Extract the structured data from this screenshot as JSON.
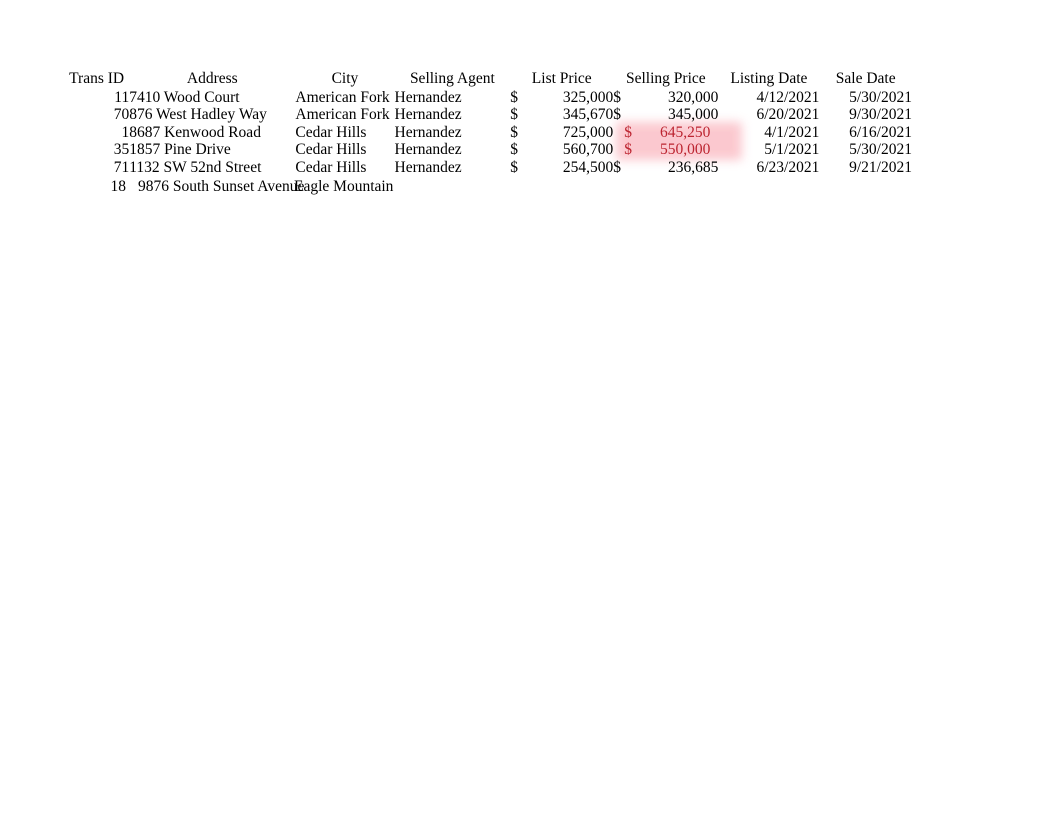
{
  "sheet": {
    "columns": [
      {
        "key": "trans_id",
        "label": "Trans ID",
        "align": "right"
      },
      {
        "key": "address",
        "label": "Address",
        "align": "left"
      },
      {
        "key": "city",
        "label": "City",
        "align": "left"
      },
      {
        "key": "selling_agent",
        "label": "Selling Agent",
        "align": "left"
      },
      {
        "key": "list_price",
        "label": "List Price",
        "align": "right"
      },
      {
        "key": "selling_price",
        "label": "Selling Price",
        "align": "right"
      },
      {
        "key": "listing_date",
        "label": "Listing Date",
        "align": "right"
      },
      {
        "key": "sale_date",
        "label": "Sale Date",
        "align": "right"
      }
    ],
    "currency_symbol": "$",
    "highlight": {
      "background": "#fbc6cd",
      "text_color": "#bc2430",
      "applies_to_column": "selling_price"
    },
    "rows": [
      {
        "trans_id": "11",
        "address": "7410 Wood Court",
        "city": "American Fork",
        "selling_agent": "Hernandez",
        "list_price": "325,000",
        "selling_price": "320,000",
        "selling_price_highlighted": false,
        "listing_date": "4/12/2021",
        "sale_date": "5/30/2021"
      },
      {
        "trans_id": "70",
        "address": "876 West Hadley Way",
        "city": "American Fork",
        "selling_agent": "Hernandez",
        "list_price": "345,670",
        "selling_price": "345,000",
        "selling_price_highlighted": false,
        "listing_date": "6/20/2021",
        "sale_date": "9/30/2021"
      },
      {
        "trans_id": "1",
        "address": "8687 Kenwood Road",
        "city": "Cedar Hills",
        "selling_agent": "Hernandez",
        "list_price": "725,000",
        "selling_price": "645,250",
        "selling_price_highlighted": true,
        "listing_date": "4/1/2021",
        "sale_date": "6/16/2021"
      },
      {
        "trans_id": "35",
        "address": "1857 Pine Drive",
        "city": "Cedar Hills",
        "selling_agent": "Hernandez",
        "list_price": "560,700",
        "selling_price": "550,000",
        "selling_price_highlighted": true,
        "listing_date": "5/1/2021",
        "sale_date": "5/30/2021"
      },
      {
        "trans_id": "71",
        "address": "1132 SW 52nd Street",
        "city": "Cedar Hills",
        "selling_agent": "Hernandez",
        "list_price": "254,500",
        "selling_price": "236,685",
        "selling_price_highlighted": false,
        "listing_date": "6/23/2021",
        "sale_date": "9/21/2021"
      }
    ],
    "fading_rows": [
      {
        "trans_id": "18",
        "address": "9876 South Sunset Avenue",
        "city": "Eagle Mountain",
        "selling_agent": "",
        "list_price": "",
        "selling_price": "",
        "listing_date": "",
        "sale_date": ""
      },
      {
        "trans_id": "",
        "address": "",
        "city": "",
        "selling_agent": "",
        "list_price": "",
        "selling_price": "",
        "listing_date": "",
        "sale_date": ""
      },
      {
        "trans_id": "",
        "address": "",
        "city": "",
        "selling_agent": "",
        "list_price": "",
        "selling_price": "",
        "listing_date": "",
        "sale_date": ""
      },
      {
        "trans_id": "",
        "address": "",
        "city": "",
        "selling_agent": "",
        "list_price": "",
        "selling_price": "",
        "listing_date": "",
        "sale_date": ""
      },
      {
        "trans_id": "",
        "address": "",
        "city": "",
        "selling_agent": "",
        "list_price": "",
        "selling_price": "",
        "listing_date": "",
        "sale_date": ""
      },
      {
        "trans_id": "",
        "address": "",
        "city": "",
        "selling_agent": "",
        "list_price": "",
        "selling_price": "",
        "listing_date": "",
        "sale_date": ""
      }
    ]
  }
}
